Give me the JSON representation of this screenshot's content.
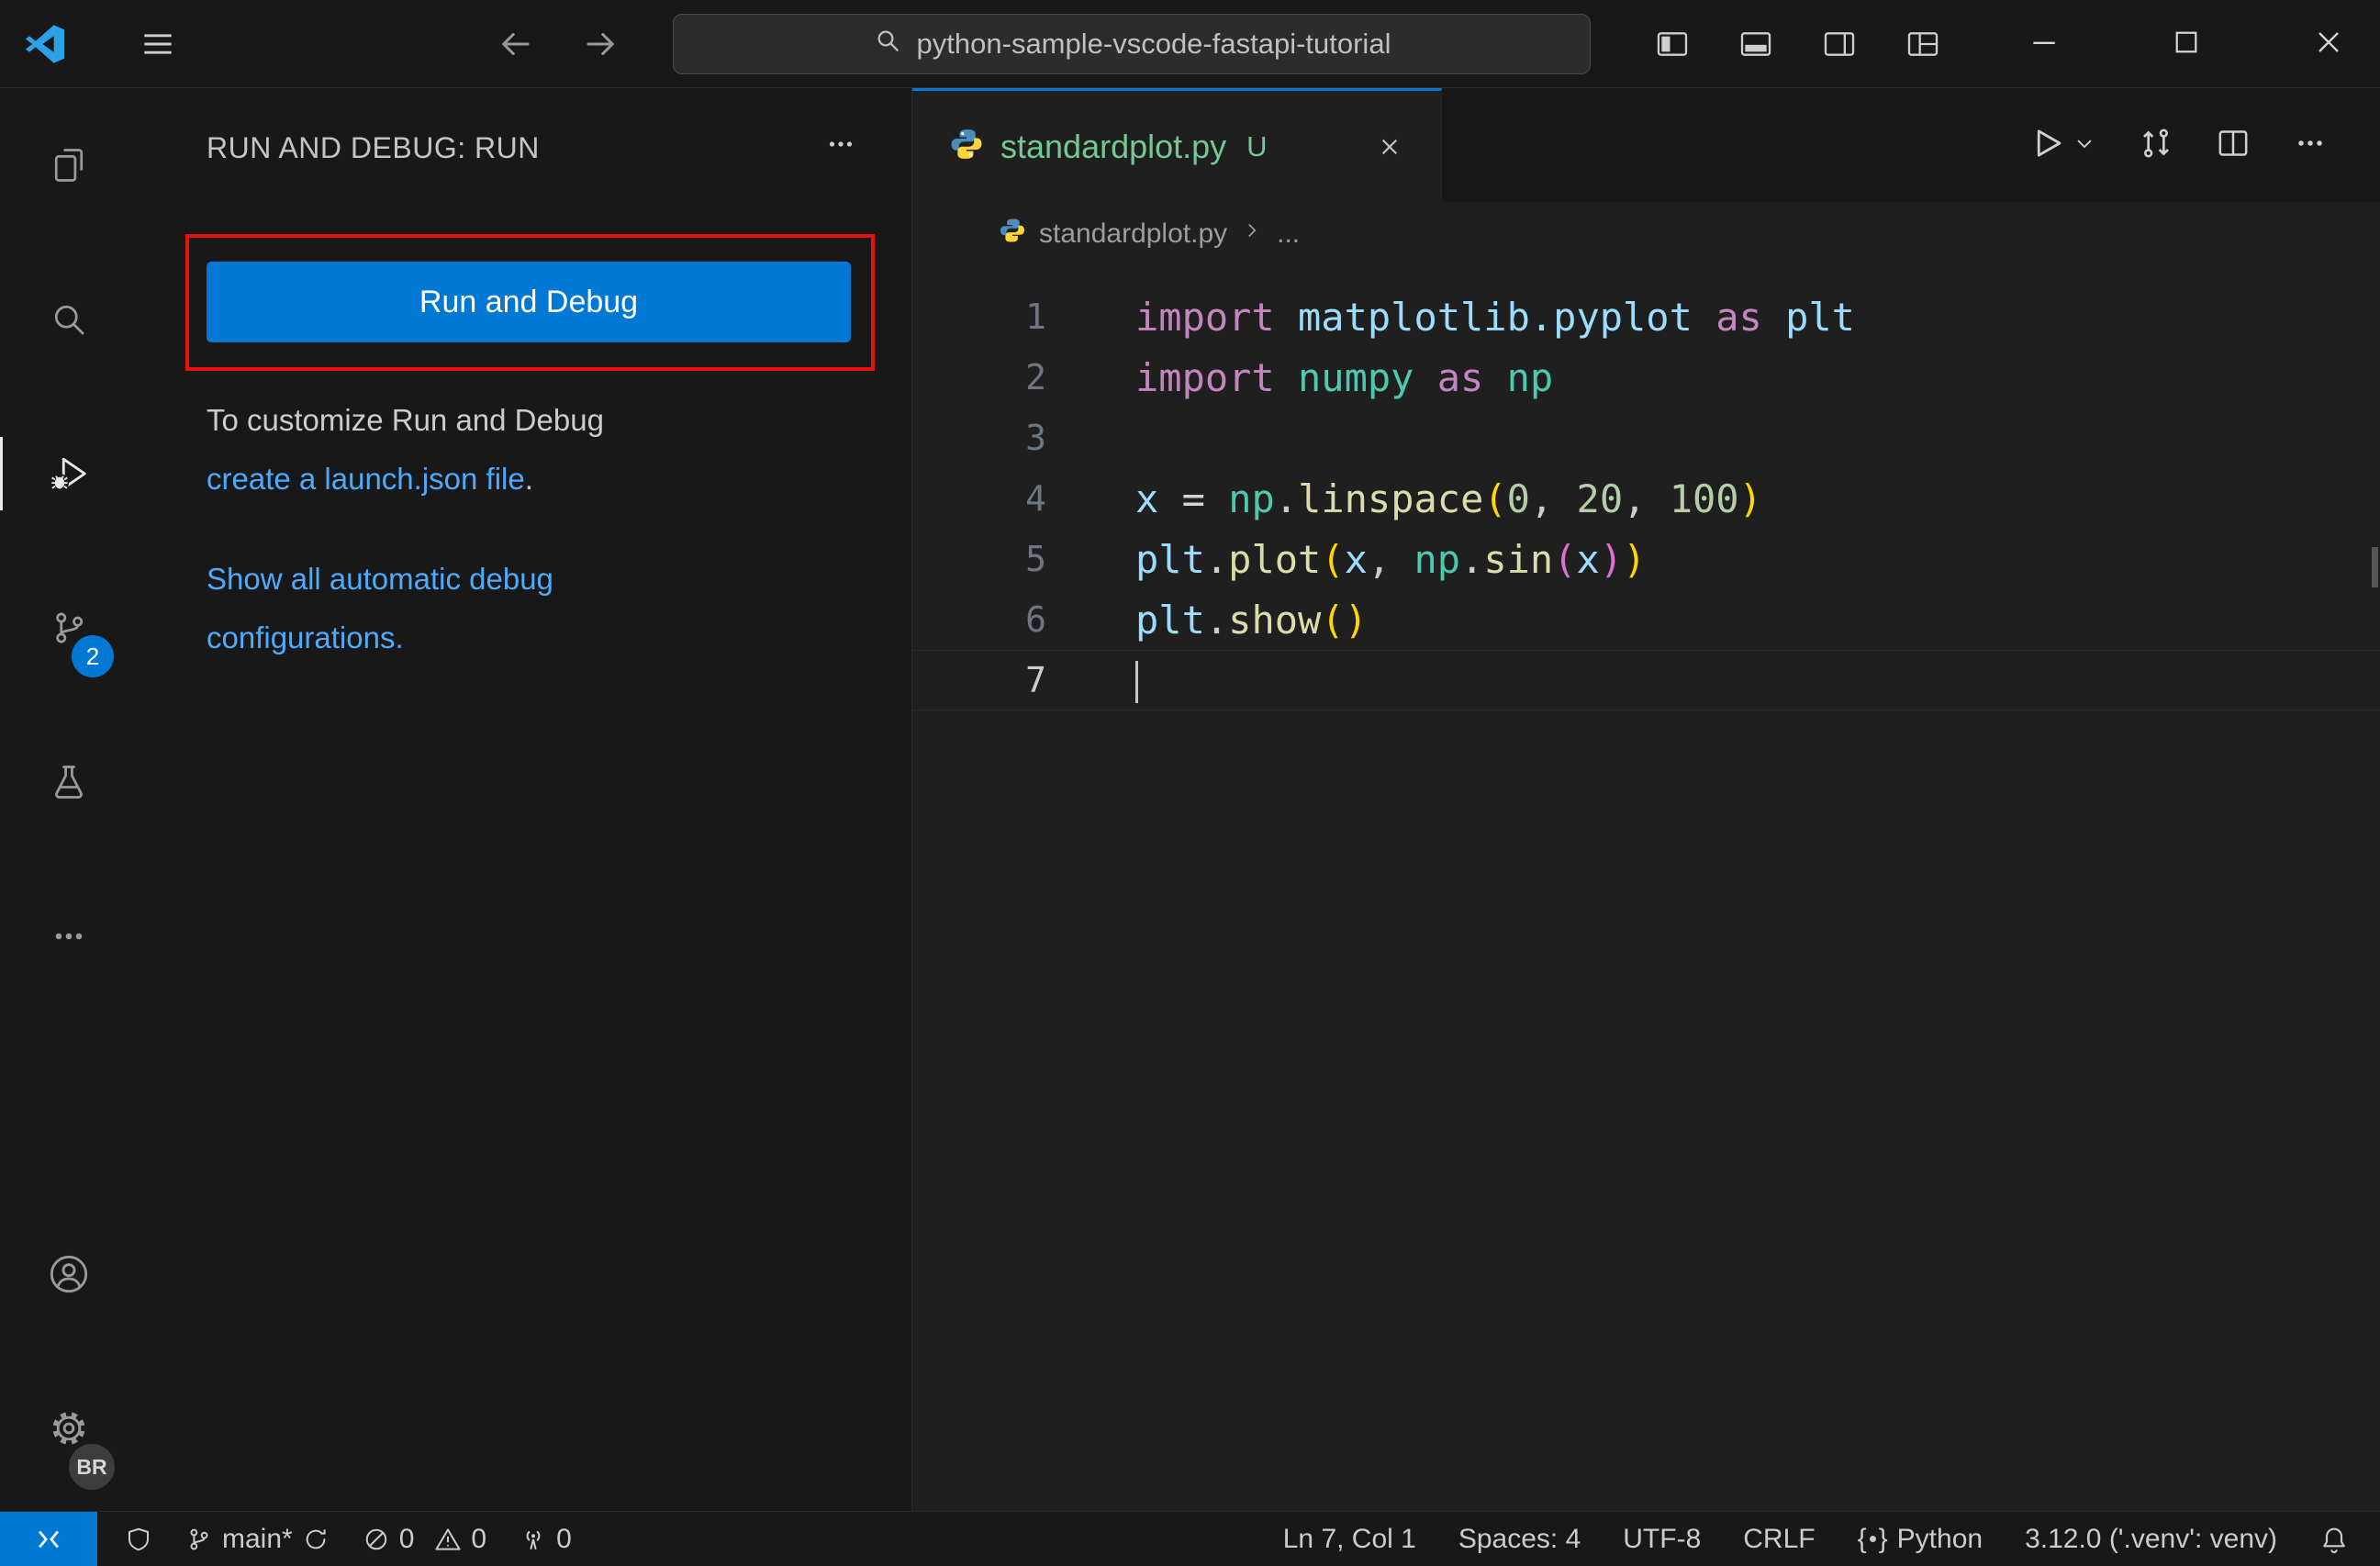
{
  "colors": {
    "accent_blue": "#0078d4",
    "link_blue": "#4daafc",
    "annotation_red": "#e80f0f",
    "untracked_green": "#73c991"
  },
  "title_bar": {
    "search_text": "python-sample-vscode-fastapi-tutorial"
  },
  "activity_bar": {
    "source_control_badge": "2",
    "profile_badge": "BR"
  },
  "sidebar": {
    "header_title": "RUN AND DEBUG: RUN",
    "run_button_label": "Run and Debug",
    "customize_line1": "To customize Run and Debug",
    "customize_link": "create a launch.json file",
    "customize_suffix": ".",
    "show_all_line1": "Show all automatic debug",
    "show_all_line2": "configurations."
  },
  "editor": {
    "tab_label": "standardplot.py",
    "tab_modified": "U",
    "breadcrumb_file": "standardplot.py",
    "breadcrumb_more": "...",
    "syntax_colors": {
      "kw": "#c586c0",
      "modb": "#9cdcfe",
      "modt": "#4ec9b0",
      "var": "#9cdcfe",
      "fn": "#dcdcaa",
      "num": "#b5cea8",
      "pl": "#cccccc",
      "op": "#d4d4d4",
      "b1": "#ffd700",
      "b2": "#da70d6",
      "ln": "#6e7681",
      "lnActive": "#cccccc"
    },
    "code": {
      "lines": [
        {
          "n": "1",
          "tokens": [
            {
              "t": "import",
              "c": "kw"
            },
            {
              "t": " ",
              "c": "pl"
            },
            {
              "t": "matplotlib.pyplot",
              "c": "modb"
            },
            {
              "t": " ",
              "c": "pl"
            },
            {
              "t": "as",
              "c": "kw"
            },
            {
              "t": " ",
              "c": "pl"
            },
            {
              "t": "plt",
              "c": "modb"
            }
          ]
        },
        {
          "n": "2",
          "tokens": [
            {
              "t": "import",
              "c": "kw"
            },
            {
              "t": " ",
              "c": "pl"
            },
            {
              "t": "numpy",
              "c": "modt"
            },
            {
              "t": " ",
              "c": "pl"
            },
            {
              "t": "as",
              "c": "kw"
            },
            {
              "t": " ",
              "c": "pl"
            },
            {
              "t": "np",
              "c": "modt"
            }
          ]
        },
        {
          "n": "3",
          "tokens": []
        },
        {
          "n": "4",
          "tokens": [
            {
              "t": "x",
              "c": "var"
            },
            {
              "t": " ",
              "c": "pl"
            },
            {
              "t": "=",
              "c": "op"
            },
            {
              "t": " ",
              "c": "pl"
            },
            {
              "t": "np",
              "c": "modt"
            },
            {
              "t": ".",
              "c": "pl"
            },
            {
              "t": "linspace",
              "c": "fn"
            },
            {
              "t": "(",
              "c": "b1"
            },
            {
              "t": "0",
              "c": "num"
            },
            {
              "t": ", ",
              "c": "pl"
            },
            {
              "t": "20",
              "c": "num"
            },
            {
              "t": ", ",
              "c": "pl"
            },
            {
              "t": "100",
              "c": "num"
            },
            {
              "t": ")",
              "c": "b1"
            }
          ]
        },
        {
          "n": "5",
          "tokens": [
            {
              "t": "plt",
              "c": "modb"
            },
            {
              "t": ".",
              "c": "pl"
            },
            {
              "t": "plot",
              "c": "fn"
            },
            {
              "t": "(",
              "c": "b1"
            },
            {
              "t": "x",
              "c": "var"
            },
            {
              "t": ", ",
              "c": "pl"
            },
            {
              "t": "np",
              "c": "modt"
            },
            {
              "t": ".",
              "c": "pl"
            },
            {
              "t": "sin",
              "c": "fn"
            },
            {
              "t": "(",
              "c": "b2"
            },
            {
              "t": "x",
              "c": "var"
            },
            {
              "t": ")",
              "c": "b2"
            },
            {
              "t": ")",
              "c": "b1"
            }
          ]
        },
        {
          "n": "6",
          "tokens": [
            {
              "t": "plt",
              "c": "modb"
            },
            {
              "t": ".",
              "c": "pl"
            },
            {
              "t": "show",
              "c": "fn"
            },
            {
              "t": "(",
              "c": "b1"
            },
            {
              "t": ")",
              "c": "b1"
            }
          ]
        },
        {
          "n": "7",
          "tokens": [],
          "active": true,
          "cursor": true
        }
      ]
    }
  },
  "status_bar": {
    "branch": "main*",
    "errors": "0",
    "warnings": "0",
    "ports": "0",
    "line_col": "Ln 7, Col 1",
    "spaces": "Spaces: 4",
    "encoding": "UTF-8",
    "eol": "CRLF",
    "language": "Python",
    "interpreter": "3.12.0 ('.venv': venv)"
  }
}
